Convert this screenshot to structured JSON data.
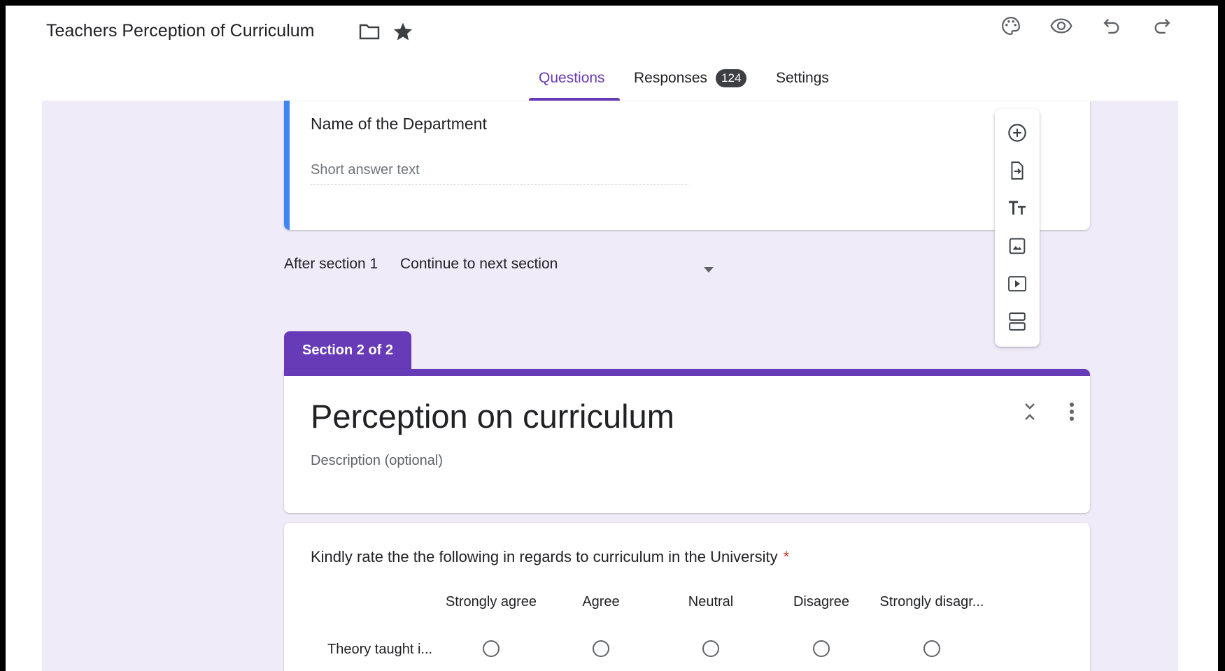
{
  "header": {
    "form_title": "Teachers Perception of Curriculum",
    "title_icons": [
      "folder-icon",
      "star-icon"
    ],
    "actions": [
      "palette-icon",
      "preview-eye-icon",
      "undo-icon",
      "redo-icon"
    ]
  },
  "tabs": {
    "questions": "Questions",
    "responses": "Responses",
    "responses_count": "124",
    "settings": "Settings",
    "active": "Questions"
  },
  "section1": {
    "question_title": "Name of the Department",
    "required_marker": "*",
    "answer_placeholder": "Short answer text",
    "after_section_label": "After section 1",
    "after_section_value": "Continue to next section"
  },
  "section2": {
    "tab_label": "Section 2 of 2",
    "title": "Perception on curriculum",
    "description_placeholder": "Description (optional)",
    "grid_question": {
      "title": "Kindly rate the the following in regards to curriculum in the University",
      "required_marker": "*",
      "columns": [
        "Strongly agree",
        "Agree",
        "Neutral",
        "Disagree",
        "Strongly disagr..."
      ],
      "rows": [
        "Theory taught i..."
      ]
    }
  },
  "toolbar": [
    "add-question-icon",
    "import-questions-icon",
    "add-title-icon",
    "add-image-icon",
    "add-video-icon",
    "add-section-icon"
  ],
  "colors": {
    "accent": "#673ab7",
    "canvas_bg": "#f0ebf8",
    "active_question_bar": "#4285f4",
    "required": "#d93025"
  }
}
